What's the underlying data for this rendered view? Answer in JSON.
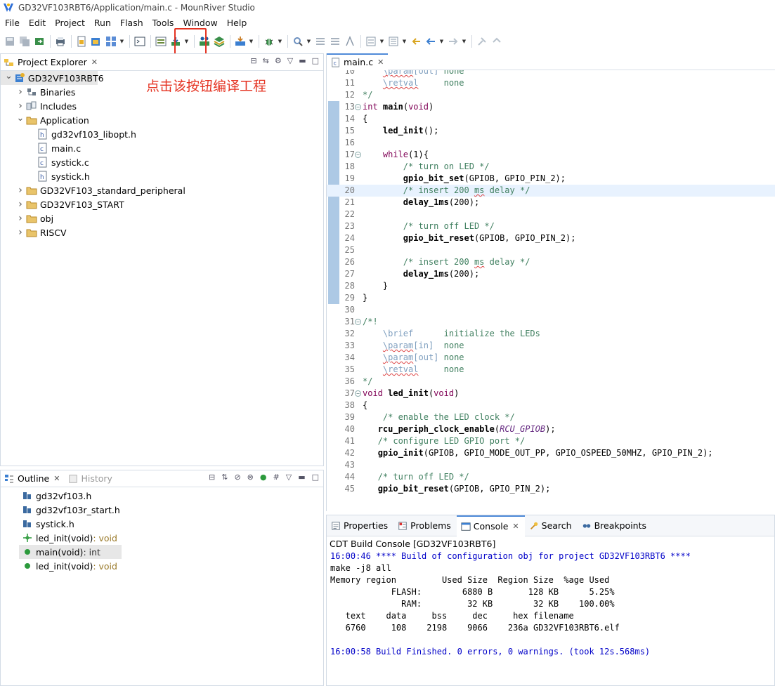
{
  "window": {
    "title": "GD32VF103RBT6/Application/main.c - MounRiver Studio"
  },
  "menu": [
    "File",
    "Edit",
    "Project",
    "Run",
    "Flash",
    "Tools",
    "Window",
    "Help"
  ],
  "annotation": "点击该按钮编译工程",
  "project_explorer": {
    "tab_label": "Project Explorer",
    "items": [
      {
        "label": "GD32VF103RBT6",
        "depth": 0,
        "arrow": "open",
        "icon": "project-icon"
      },
      {
        "label": "Binaries",
        "depth": 1,
        "arrow": "closed",
        "icon": "binaries-icon"
      },
      {
        "label": "Includes",
        "depth": 1,
        "arrow": "closed",
        "icon": "includes-icon"
      },
      {
        "label": "Application",
        "depth": 1,
        "arrow": "open",
        "icon": "folder-icon"
      },
      {
        "label": "gd32vf103_libopt.h",
        "depth": 2,
        "arrow": "none",
        "icon": "header-file-icon"
      },
      {
        "label": "main.c",
        "depth": 2,
        "arrow": "none",
        "icon": "c-file-icon"
      },
      {
        "label": "systick.c",
        "depth": 2,
        "arrow": "none",
        "icon": "c-file-icon"
      },
      {
        "label": "systick.h",
        "depth": 2,
        "arrow": "none",
        "icon": "header-file-icon"
      },
      {
        "label": "GD32VF103_standard_peripheral",
        "depth": 1,
        "arrow": "closed",
        "icon": "folder-icon"
      },
      {
        "label": "GD32VF103_START",
        "depth": 1,
        "arrow": "closed",
        "icon": "folder-icon"
      },
      {
        "label": "obj",
        "depth": 1,
        "arrow": "closed",
        "icon": "folder-icon"
      },
      {
        "label": "RISCV",
        "depth": 1,
        "arrow": "closed",
        "icon": "folder-icon"
      }
    ]
  },
  "outline": {
    "tab_label": "Outline",
    "history_label": "History",
    "items": [
      {
        "label": "gd32vf103.h",
        "suffix": "",
        "icon": "include-icon"
      },
      {
        "label": "gd32vf103r_start.h",
        "suffix": "",
        "icon": "include-icon"
      },
      {
        "label": "systick.h",
        "suffix": "",
        "icon": "include-icon"
      },
      {
        "label": "led_init(void)",
        "suffix": " : void",
        "icon": "function-decl-icon"
      },
      {
        "label": "main(void)",
        "suffix": " : int",
        "icon": "function-icon",
        "selected": true
      },
      {
        "label": "led_init(void)",
        "suffix": " : void",
        "icon": "function-icon"
      }
    ]
  },
  "editor": {
    "tab_label": "main.c",
    "lines": [
      {
        "n": "10",
        "t": "    \\param[out] none",
        "k": "cm"
      },
      {
        "n": "11",
        "t": "    \\retval     none",
        "k": "cm"
      },
      {
        "n": "12",
        "t": "*/",
        "k": "cm"
      },
      {
        "n": "13",
        "t": "int main(void)",
        "k": "decl_main",
        "fold": true
      },
      {
        "n": "14",
        "t": "{",
        "k": "plain"
      },
      {
        "n": "15",
        "t": "    led_init();",
        "k": "call"
      },
      {
        "n": "16",
        "t": "",
        "k": "plain"
      },
      {
        "n": "17",
        "t": "    while(1){",
        "k": "while",
        "fold": true
      },
      {
        "n": "18",
        "t": "        /* turn on LED */",
        "k": "cm"
      },
      {
        "n": "19",
        "t": "        gpio_bit_set(GPIOB, GPIO_PIN_2);",
        "k": "call"
      },
      {
        "n": "20",
        "t": "        /* insert 200 ms delay */",
        "k": "cm",
        "current": true
      },
      {
        "n": "21",
        "t": "        delay_1ms(200);",
        "k": "call"
      },
      {
        "n": "22",
        "t": "",
        "k": "plain"
      },
      {
        "n": "23",
        "t": "        /* turn off LED */",
        "k": "cm"
      },
      {
        "n": "24",
        "t": "        gpio_bit_reset(GPIOB, GPIO_PIN_2);",
        "k": "call"
      },
      {
        "n": "25",
        "t": "",
        "k": "plain"
      },
      {
        "n": "26",
        "t": "        /* insert 200 ms delay */",
        "k": "cm"
      },
      {
        "n": "27",
        "t": "        delay_1ms(200);",
        "k": "call"
      },
      {
        "n": "28",
        "t": "    }",
        "k": "plain"
      },
      {
        "n": "29",
        "t": "}",
        "k": "plain"
      },
      {
        "n": "30",
        "t": "",
        "k": "plain"
      },
      {
        "n": "31",
        "t": "/*!",
        "k": "cm",
        "fold": true
      },
      {
        "n": "32",
        "t": "    \\brief      initialize the LEDs",
        "k": "cm"
      },
      {
        "n": "33",
        "t": "    \\param[in]  none",
        "k": "cm"
      },
      {
        "n": "34",
        "t": "    \\param[out] none",
        "k": "cm"
      },
      {
        "n": "35",
        "t": "    \\retval     none",
        "k": "cm"
      },
      {
        "n": "36",
        "t": "*/",
        "k": "cm"
      },
      {
        "n": "37",
        "t": "void led_init(void)",
        "k": "decl_void",
        "fold": true
      },
      {
        "n": "38",
        "t": "{",
        "k": "plain"
      },
      {
        "n": "39",
        "t": "    /* enable the LED clock */",
        "k": "cm"
      },
      {
        "n": "40",
        "t": "   rcu_periph_clock_enable(RCU_GPIOB);",
        "k": "rcu"
      },
      {
        "n": "41",
        "t": "   /* configure LED GPIO port */",
        "k": "cm"
      },
      {
        "n": "42",
        "t": "   gpio_init(GPIOB, GPIO_MODE_OUT_PP, GPIO_OSPEED_50MHZ, GPIO_PIN_2);",
        "k": "call"
      },
      {
        "n": "43",
        "t": "",
        "k": "plain"
      },
      {
        "n": "44",
        "t": "   /* turn off LED */",
        "k": "cm"
      },
      {
        "n": "45",
        "t": "   gpio_bit_reset(GPIOB, GPIO_PIN_2);",
        "k": "call"
      }
    ]
  },
  "bottom_tabs": [
    {
      "label": "Properties",
      "icon": "properties-icon"
    },
    {
      "label": "Problems",
      "icon": "problems-icon"
    },
    {
      "label": "Console",
      "icon": "console-icon",
      "active": true
    },
    {
      "label": "Search",
      "icon": "search-icon"
    },
    {
      "label": "Breakpoints",
      "icon": "breakpoints-icon"
    }
  ],
  "console": {
    "title": "CDT Build Console [GD32VF103RBT6]",
    "lines": [
      {
        "t": "16:00:46 **** Build of configuration obj for project GD32VF103RBT6 ****",
        "blue": true
      },
      {
        "t": "make -j8 all",
        "blue": false
      },
      {
        "t": "Memory region         Used Size  Region Size  %age Used",
        "blue": false
      },
      {
        "t": "            FLASH:        6880 B       128 KB      5.25%",
        "blue": false
      },
      {
        "t": "              RAM:         32 KB        32 KB    100.00%",
        "blue": false
      },
      {
        "t": "   text    data     bss     dec     hex filename",
        "blue": false
      },
      {
        "t": "   6760     108    2198    9066    236a GD32VF103RBT6.elf",
        "blue": false
      },
      {
        "t": "",
        "blue": false
      },
      {
        "t": "16:00:58 Build Finished. 0 errors, 0 warnings. (took 12s.568ms)",
        "blue": true
      }
    ]
  },
  "colors": {
    "annotation": "#e53322",
    "highlight_box": "#e53322",
    "console_blue": "#0000c8",
    "active_tab_border": "#4f8ad8"
  }
}
